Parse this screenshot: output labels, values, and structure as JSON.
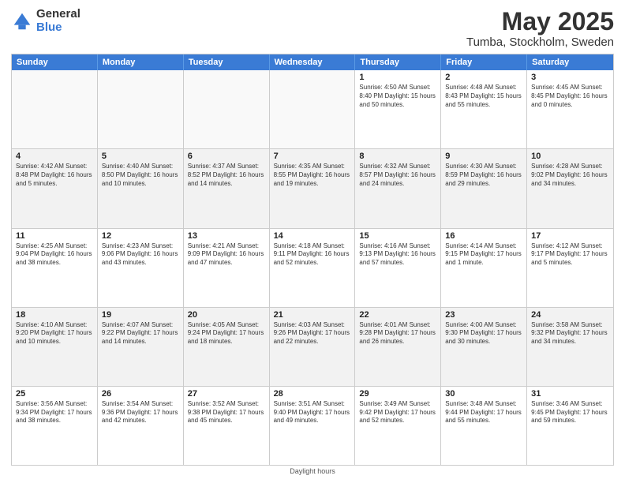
{
  "app": {
    "logo_general": "General",
    "logo_blue": "Blue",
    "title": "May 2025",
    "subtitle": "Tumba, Stockholm, Sweden"
  },
  "calendar": {
    "days_of_week": [
      "Sunday",
      "Monday",
      "Tuesday",
      "Wednesday",
      "Thursday",
      "Friday",
      "Saturday"
    ],
    "rows": [
      [
        {
          "day": "",
          "info": "",
          "empty": true
        },
        {
          "day": "",
          "info": "",
          "empty": true
        },
        {
          "day": "",
          "info": "",
          "empty": true
        },
        {
          "day": "",
          "info": "",
          "empty": true
        },
        {
          "day": "1",
          "info": "Sunrise: 4:50 AM\nSunset: 8:40 PM\nDaylight: 15 hours\nand 50 minutes."
        },
        {
          "day": "2",
          "info": "Sunrise: 4:48 AM\nSunset: 8:43 PM\nDaylight: 15 hours\nand 55 minutes."
        },
        {
          "day": "3",
          "info": "Sunrise: 4:45 AM\nSunset: 8:45 PM\nDaylight: 16 hours\nand 0 minutes."
        }
      ],
      [
        {
          "day": "4",
          "info": "Sunrise: 4:42 AM\nSunset: 8:48 PM\nDaylight: 16 hours\nand 5 minutes."
        },
        {
          "day": "5",
          "info": "Sunrise: 4:40 AM\nSunset: 8:50 PM\nDaylight: 16 hours\nand 10 minutes."
        },
        {
          "day": "6",
          "info": "Sunrise: 4:37 AM\nSunset: 8:52 PM\nDaylight: 16 hours\nand 14 minutes."
        },
        {
          "day": "7",
          "info": "Sunrise: 4:35 AM\nSunset: 8:55 PM\nDaylight: 16 hours\nand 19 minutes."
        },
        {
          "day": "8",
          "info": "Sunrise: 4:32 AM\nSunset: 8:57 PM\nDaylight: 16 hours\nand 24 minutes."
        },
        {
          "day": "9",
          "info": "Sunrise: 4:30 AM\nSunset: 8:59 PM\nDaylight: 16 hours\nand 29 minutes."
        },
        {
          "day": "10",
          "info": "Sunrise: 4:28 AM\nSunset: 9:02 PM\nDaylight: 16 hours\nand 34 minutes."
        }
      ],
      [
        {
          "day": "11",
          "info": "Sunrise: 4:25 AM\nSunset: 9:04 PM\nDaylight: 16 hours\nand 38 minutes."
        },
        {
          "day": "12",
          "info": "Sunrise: 4:23 AM\nSunset: 9:06 PM\nDaylight: 16 hours\nand 43 minutes."
        },
        {
          "day": "13",
          "info": "Sunrise: 4:21 AM\nSunset: 9:09 PM\nDaylight: 16 hours\nand 47 minutes."
        },
        {
          "day": "14",
          "info": "Sunrise: 4:18 AM\nSunset: 9:11 PM\nDaylight: 16 hours\nand 52 minutes."
        },
        {
          "day": "15",
          "info": "Sunrise: 4:16 AM\nSunset: 9:13 PM\nDaylight: 16 hours\nand 57 minutes."
        },
        {
          "day": "16",
          "info": "Sunrise: 4:14 AM\nSunset: 9:15 PM\nDaylight: 17 hours\nand 1 minute."
        },
        {
          "day": "17",
          "info": "Sunrise: 4:12 AM\nSunset: 9:17 PM\nDaylight: 17 hours\nand 5 minutes."
        }
      ],
      [
        {
          "day": "18",
          "info": "Sunrise: 4:10 AM\nSunset: 9:20 PM\nDaylight: 17 hours\nand 10 minutes."
        },
        {
          "day": "19",
          "info": "Sunrise: 4:07 AM\nSunset: 9:22 PM\nDaylight: 17 hours\nand 14 minutes."
        },
        {
          "day": "20",
          "info": "Sunrise: 4:05 AM\nSunset: 9:24 PM\nDaylight: 17 hours\nand 18 minutes."
        },
        {
          "day": "21",
          "info": "Sunrise: 4:03 AM\nSunset: 9:26 PM\nDaylight: 17 hours\nand 22 minutes."
        },
        {
          "day": "22",
          "info": "Sunrise: 4:01 AM\nSunset: 9:28 PM\nDaylight: 17 hours\nand 26 minutes."
        },
        {
          "day": "23",
          "info": "Sunrise: 4:00 AM\nSunset: 9:30 PM\nDaylight: 17 hours\nand 30 minutes."
        },
        {
          "day": "24",
          "info": "Sunrise: 3:58 AM\nSunset: 9:32 PM\nDaylight: 17 hours\nand 34 minutes."
        }
      ],
      [
        {
          "day": "25",
          "info": "Sunrise: 3:56 AM\nSunset: 9:34 PM\nDaylight: 17 hours\nand 38 minutes."
        },
        {
          "day": "26",
          "info": "Sunrise: 3:54 AM\nSunset: 9:36 PM\nDaylight: 17 hours\nand 42 minutes."
        },
        {
          "day": "27",
          "info": "Sunrise: 3:52 AM\nSunset: 9:38 PM\nDaylight: 17 hours\nand 45 minutes."
        },
        {
          "day": "28",
          "info": "Sunrise: 3:51 AM\nSunset: 9:40 PM\nDaylight: 17 hours\nand 49 minutes."
        },
        {
          "day": "29",
          "info": "Sunrise: 3:49 AM\nSunset: 9:42 PM\nDaylight: 17 hours\nand 52 minutes."
        },
        {
          "day": "30",
          "info": "Sunrise: 3:48 AM\nSunset: 9:44 PM\nDaylight: 17 hours\nand 55 minutes."
        },
        {
          "day": "31",
          "info": "Sunrise: 3:46 AM\nSunset: 9:45 PM\nDaylight: 17 hours\nand 59 minutes."
        }
      ]
    ]
  },
  "footer": {
    "daylight_label": "Daylight hours"
  }
}
